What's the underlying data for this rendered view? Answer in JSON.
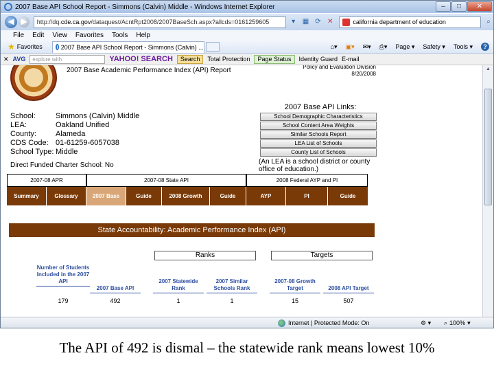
{
  "browser": {
    "window_title": "2007 Base API School Report - Simmons (Calvin) Middle - Windows Internet Explorer",
    "url_prefix": "http://dq.",
    "url_host": "cde.ca.gov",
    "url_rest": "/dataquest/AcntRpt2008/2007BaseSch.aspx?allcds=0161259605",
    "search_text": "california department of education",
    "menu": [
      "File",
      "Edit",
      "View",
      "Favorites",
      "Tools",
      "Help"
    ],
    "favorites_label": "Favorites",
    "tab_label": "2007 Base API School Report - Simmons (Calvin) ...",
    "command_bar": {
      "page": "Page ▾",
      "safety": "Safety ▾",
      "tools": "Tools ▾",
      "help": "?"
    },
    "avg_toolbar": {
      "avg_label": "AVG",
      "explore_placeholder": "explore with",
      "yahoo_label": "YAHOO! SEARCH",
      "search_button": "Search",
      "total_protection": "Total Protection",
      "page_status": "Page Status",
      "identity_guard": "Identity Guard",
      "email": "E-mail"
    },
    "status": {
      "zone": "Internet | Protected Mode: On",
      "zoom": "100%"
    }
  },
  "report": {
    "title": "2007 Base Academic Performance Index (API) Report",
    "division_line1": "Policy and Evaluation Division",
    "division_line2": "8/20/2008",
    "school_info": [
      {
        "label": "School:",
        "value": "Simmons (Calvin) Middle"
      },
      {
        "label": "LEA:",
        "value": "Oakland Unified"
      },
      {
        "label": "County:",
        "value": "Alameda"
      },
      {
        "label": "CDS Code:",
        "value": "01-61259-6057038"
      },
      {
        "label": "School Type:",
        "value": "Middle"
      }
    ],
    "charter": "Direct Funded Charter School: No",
    "links_header": "2007 Base API Links:",
    "links": [
      "School Demographic Characteristics",
      "School Content Area Weights",
      "Similar Schools Report",
      "LEA List of Schools",
      "County List of Schools"
    ],
    "links_note": "(An LEA is a school district or county office of education.)",
    "nav_groups": [
      "2007-08 APR",
      "2007-08 State API",
      "2008 Federal AYP and PI"
    ],
    "nav_tabs": [
      "Summary",
      "Glossary",
      "2007 Base",
      "Guide",
      "2008 Growth",
      "Guide",
      "AYP",
      "PI",
      "Guide"
    ],
    "section_title": "State Accountability: Academic Performance Index (API)",
    "ranks_header": "Ranks",
    "targets_header": "Targets",
    "columns": [
      "Number of Students Included in the 2007 API",
      "2007 Base API",
      "2007 Statewide Rank",
      "2007 Similar Schools Rank",
      "2007-08 Growth Target",
      "2008 API Target"
    ],
    "values": [
      "179",
      "492",
      "1",
      "1",
      "15",
      "507"
    ]
  },
  "caption": "The API of 492 is dismal – the statewide rank means lowest 10%"
}
